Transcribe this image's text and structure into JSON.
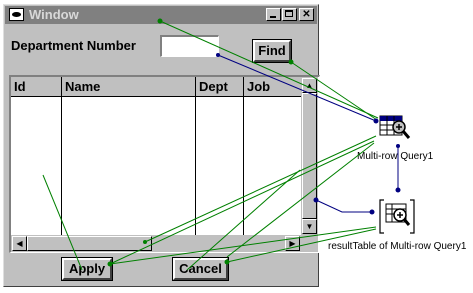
{
  "window": {
    "title": "Window",
    "controls": [
      "minimize",
      "maximize",
      "close"
    ]
  },
  "form": {
    "department_label": "Department Number",
    "department_value": "",
    "find_label": "Find",
    "apply_label": "Apply",
    "cancel_label": "Cancel"
  },
  "table": {
    "columns": [
      "Id",
      "Name",
      "Dept",
      "Job"
    ],
    "rows": []
  },
  "queries": [
    {
      "label": "Multi-row Query1",
      "icon": "query-table-icon"
    },
    {
      "label": "resultTable of Multi-row Query1",
      "icon": "result-table-icon"
    }
  ],
  "colors": {
    "window_bg": "#c0c0c0",
    "title_bg": "#808080",
    "wire_green": "#008000",
    "wire_navy": "#000080"
  }
}
